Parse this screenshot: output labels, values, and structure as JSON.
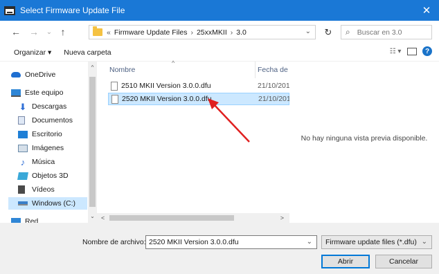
{
  "window": {
    "title": "Select Firmware Update File",
    "close_glyph": "✕"
  },
  "nav": {
    "back_glyph": "←",
    "forward_glyph": "→",
    "recent_glyph": "⌄",
    "up_glyph": "↑"
  },
  "address": {
    "overflow": "«",
    "segments": [
      "Firmware Update Files",
      "25xxMKII",
      "3.0"
    ],
    "separator": "›",
    "dropdown_glyph": "⌄"
  },
  "refresh_glyph": "↻",
  "search": {
    "placeholder": "Buscar en 3.0",
    "icon_glyph": "⌕"
  },
  "toolbar": {
    "organize": "Organizar ▾",
    "new_folder": "Nueva carpeta",
    "view_glyph": "☷ ▾",
    "help_glyph": "?"
  },
  "sidebar": {
    "items": [
      {
        "label": "OneDrive",
        "icon": "cloud-icon",
        "color": "#1f6fd1"
      },
      {
        "label": "Este equipo",
        "icon": "computer-icon",
        "color": "#2f86d6"
      },
      {
        "label": "Descargas",
        "icon": "download-icon",
        "color": "#2f6fd6"
      },
      {
        "label": "Documentos",
        "icon": "documents-icon",
        "color": "#8aa4c8"
      },
      {
        "label": "Escritorio",
        "icon": "desktop-icon",
        "color": "#1f7fd6"
      },
      {
        "label": "Imágenes",
        "icon": "pictures-icon",
        "color": "#6a8aa8"
      },
      {
        "label": "Música",
        "icon": "music-icon",
        "color": "#2f6fd6"
      },
      {
        "label": "Objetos 3D",
        "icon": "objects-3d-icon",
        "color": "#3aa8d8"
      },
      {
        "label": "Vídeos",
        "icon": "videos-icon",
        "color": "#4a4a4a"
      },
      {
        "label": "Windows (C:)",
        "icon": "drive-icon",
        "color": "#3a7fc8"
      },
      {
        "label": "Red",
        "icon": "network-icon",
        "color": "#2f86d6"
      }
    ]
  },
  "files": {
    "columns": {
      "name": "Nombre",
      "date": "Fecha de"
    },
    "sort_glyph": "^",
    "rows": [
      {
        "name": "2510 MKII Version 3.0.0.dfu",
        "date": "21/10/201"
      },
      {
        "name": "2520 MKII Version 3.0.0.dfu",
        "date": "21/10/201"
      }
    ]
  },
  "preview": {
    "message": "No hay ninguna vista previa disponible."
  },
  "scroll": {
    "up": "^",
    "down": "⌄",
    "left": "<",
    "right": ">"
  },
  "bottom": {
    "filename_label": "Nombre de archivo:",
    "filename_value": "2520 MKII Version 3.0.0.dfu",
    "filter": "Firmware update files (*.dfu)",
    "dropdown_glyph": "⌄",
    "open": "Abrir",
    "cancel": "Cancelar"
  },
  "colors": {
    "titlebar": "#1a78d6",
    "selection": "#cce8ff",
    "annotation_arrow": "#e02020"
  }
}
